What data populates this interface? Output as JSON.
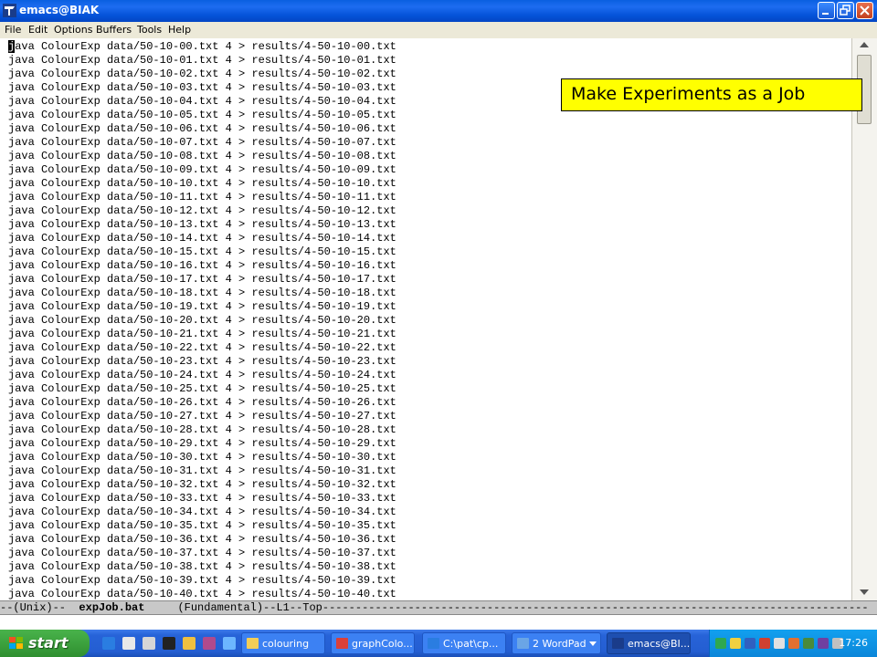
{
  "window": {
    "title": "emacs@BIAK",
    "menu": [
      "File",
      "Edit",
      "Options",
      "Buffers",
      "Tools",
      "Help"
    ]
  },
  "buffer": {
    "lines": [
      "java ColourExp data/50-10-00.txt 4 > results/4-50-10-00.txt",
      "java ColourExp data/50-10-01.txt 4 > results/4-50-10-01.txt",
      "java ColourExp data/50-10-02.txt 4 > results/4-50-10-02.txt",
      "java ColourExp data/50-10-03.txt 4 > results/4-50-10-03.txt",
      "java ColourExp data/50-10-04.txt 4 > results/4-50-10-04.txt",
      "java ColourExp data/50-10-05.txt 4 > results/4-50-10-05.txt",
      "java ColourExp data/50-10-06.txt 4 > results/4-50-10-06.txt",
      "java ColourExp data/50-10-07.txt 4 > results/4-50-10-07.txt",
      "java ColourExp data/50-10-08.txt 4 > results/4-50-10-08.txt",
      "java ColourExp data/50-10-09.txt 4 > results/4-50-10-09.txt",
      "java ColourExp data/50-10-10.txt 4 > results/4-50-10-10.txt",
      "java ColourExp data/50-10-11.txt 4 > results/4-50-10-11.txt",
      "java ColourExp data/50-10-12.txt 4 > results/4-50-10-12.txt",
      "java ColourExp data/50-10-13.txt 4 > results/4-50-10-13.txt",
      "java ColourExp data/50-10-14.txt 4 > results/4-50-10-14.txt",
      "java ColourExp data/50-10-15.txt 4 > results/4-50-10-15.txt",
      "java ColourExp data/50-10-16.txt 4 > results/4-50-10-16.txt",
      "java ColourExp data/50-10-17.txt 4 > results/4-50-10-17.txt",
      "java ColourExp data/50-10-18.txt 4 > results/4-50-10-18.txt",
      "java ColourExp data/50-10-19.txt 4 > results/4-50-10-19.txt",
      "java ColourExp data/50-10-20.txt 4 > results/4-50-10-20.txt",
      "java ColourExp data/50-10-21.txt 4 > results/4-50-10-21.txt",
      "java ColourExp data/50-10-22.txt 4 > results/4-50-10-22.txt",
      "java ColourExp data/50-10-23.txt 4 > results/4-50-10-23.txt",
      "java ColourExp data/50-10-24.txt 4 > results/4-50-10-24.txt",
      "java ColourExp data/50-10-25.txt 4 > results/4-50-10-25.txt",
      "java ColourExp data/50-10-26.txt 4 > results/4-50-10-26.txt",
      "java ColourExp data/50-10-27.txt 4 > results/4-50-10-27.txt",
      "java ColourExp data/50-10-28.txt 4 > results/4-50-10-28.txt",
      "java ColourExp data/50-10-29.txt 4 > results/4-50-10-29.txt",
      "java ColourExp data/50-10-30.txt 4 > results/4-50-10-30.txt",
      "java ColourExp data/50-10-31.txt 4 > results/4-50-10-31.txt",
      "java ColourExp data/50-10-32.txt 4 > results/4-50-10-32.txt",
      "java ColourExp data/50-10-33.txt 4 > results/4-50-10-33.txt",
      "java ColourExp data/50-10-34.txt 4 > results/4-50-10-34.txt",
      "java ColourExp data/50-10-35.txt 4 > results/4-50-10-35.txt",
      "java ColourExp data/50-10-36.txt 4 > results/4-50-10-36.txt",
      "java ColourExp data/50-10-37.txt 4 > results/4-50-10-37.txt",
      "java ColourExp data/50-10-38.txt 4 > results/4-50-10-38.txt",
      "java ColourExp data/50-10-39.txt 4 > results/4-50-10-39.txt",
      "java ColourExp data/50-10-40.txt 4 > results/4-50-10-40.txt"
    ]
  },
  "modeline": {
    "prefix": "--(Unix)--  ",
    "filename": "expJob.bat",
    "suffix": "     (Fundamental)--L1--Top-----------------------------------------------------------------------------------"
  },
  "overlay": {
    "text": "Make Experiments as a Job"
  },
  "taskbar": {
    "start_label": "start",
    "tasks": [
      "colouring",
      "graphColo...",
      "C:\\pat\\cp...",
      "2 WordPad",
      "emacs@BI..."
    ],
    "clock": "17:26"
  },
  "colors": {
    "titlebar": "#0553d9",
    "taskbar": "#245ed2",
    "start_button": "#3aa23c",
    "overlay_bg": "#ffff00",
    "tray": "#0f96e6"
  }
}
